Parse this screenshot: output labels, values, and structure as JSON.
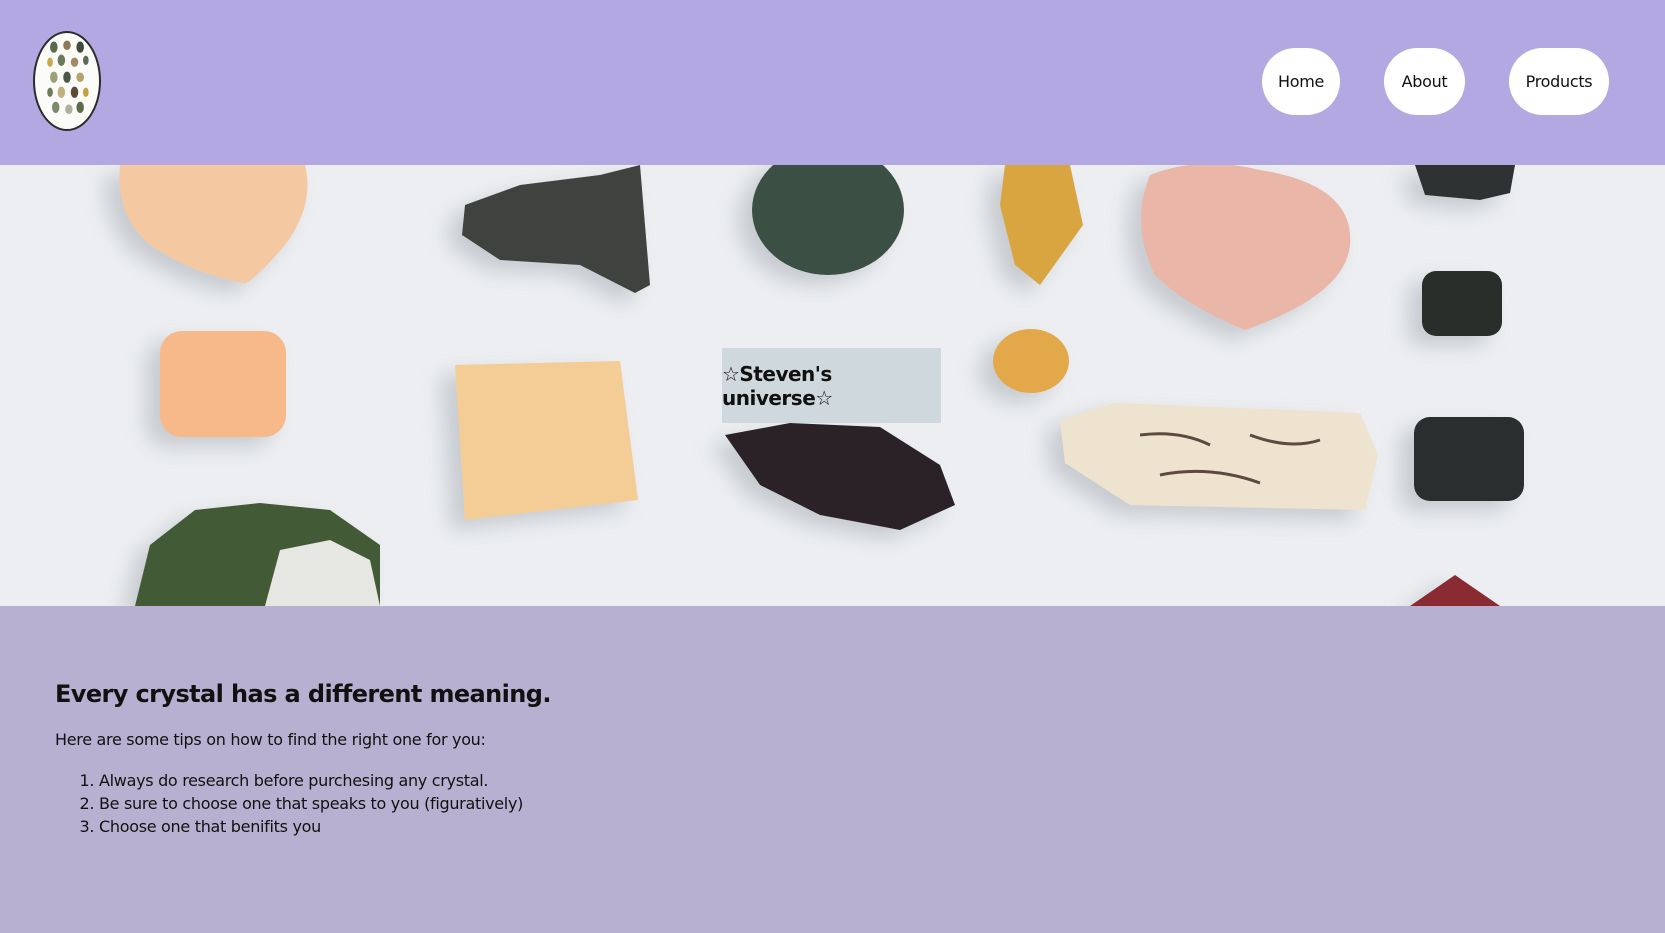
{
  "header": {
    "logo_icon": "crystal-collection-logo-icon",
    "nav": [
      {
        "label": "Home"
      },
      {
        "label": "About"
      },
      {
        "label": "Products"
      }
    ]
  },
  "hero": {
    "title": "☆Steven's universe☆",
    "background_image": "crystals-photo"
  },
  "main": {
    "heading": "Every crystal has a different meaning.",
    "intro": "Here are some tips on how to find the right one for you:",
    "tips": [
      "Always do research before purchesing any crystal.",
      "Be sure to choose one that speaks to you (figuratively)",
      "Choose one that benifits you"
    ]
  },
  "colors": {
    "header_bg": "#b3a8e1",
    "page_bg": "#b8b0d0",
    "hero_bg": "#eceef1",
    "title_box_bg": "#cfd8dc",
    "nav_button_bg": "#ffffff"
  }
}
